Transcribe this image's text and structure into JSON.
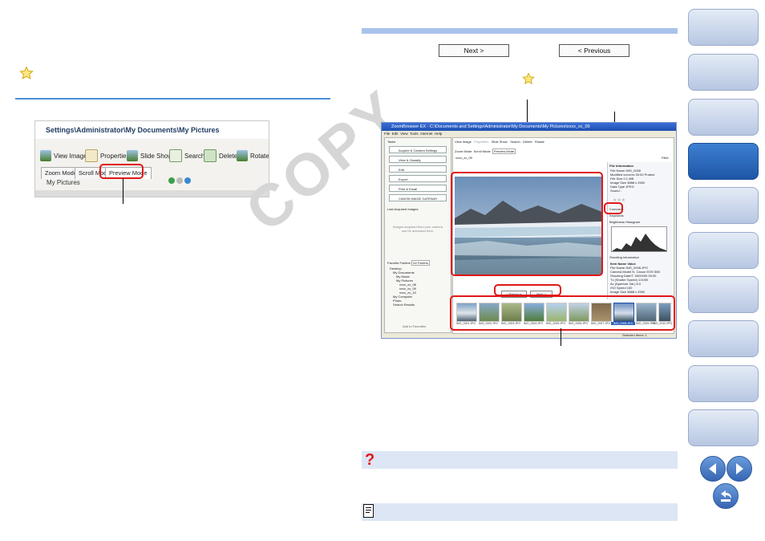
{
  "watermark": "COPY",
  "left": {
    "screenshot": {
      "path": "Settings\\Administrator\\My Documents\\My Pictures",
      "toolbar": {
        "view_image": "View Image",
        "properties": "Properties",
        "slide_show": "Slide Show",
        "search": "Search",
        "delete": "Delete",
        "rotate": "Rotate"
      },
      "tabs": [
        "Zoom Mode",
        "Scroll Mode",
        "Preview Mode"
      ],
      "folder_label": "My Pictures"
    }
  },
  "right": {
    "next_label": "Next >",
    "previous_label": "< Previous",
    "screenshot": {
      "title": "ZoomBrowser EX  -  C:\\Documents and Settings\\Administrator\\My Documents\\My Pictures\\xxxx_xx_09",
      "menu": [
        "File",
        "Edit",
        "View",
        "Tools",
        "Internet",
        "Help"
      ],
      "tasks_header": "Tasks",
      "tasks": [
        "Acquire & Camera Settings",
        "View & Classify",
        "Edit",
        "Export",
        "Print & Email",
        "CANON iMAGE GATEWAY"
      ],
      "last_acquired": "Last Acquired Images",
      "last_acquired_hint": "Images acquired from your camera can be accessed here.",
      "folder_tabs": [
        "Favorite Folders",
        "All Folders"
      ],
      "tree": [
        "Desktop",
        "My Documents",
        "My Music",
        "My Pictures",
        "xxxx_xx_08",
        "xxxx_xx_09",
        "xxxx_xx_10",
        "My Computer",
        "Photo",
        "Search Results"
      ],
      "add_favorites": "Add to Favorites",
      "toolbar": [
        "View Image",
        "Properties",
        "Slide Show",
        "Search",
        "Delete",
        "Rotate"
      ],
      "mode_tabs": [
        "Zoom Mode",
        "Scroll Mode",
        "Preview Mode"
      ],
      "folder_path": "xxxx_xx_09",
      "filter": "Filter",
      "prev_btn": "< Previous",
      "next_btn": "Next >",
      "info_header": "File Information",
      "info": [
        {
          "k": "File Name",
          "v": "IMG_0006"
        },
        {
          "k": "Modified",
          "v": "xx/xx/xx 00:00"
        },
        {
          "k": "File Size",
          "v": "0.1 MB"
        },
        {
          "k": "Image Size",
          "v": "3888 x 2592"
        },
        {
          "k": "Data Type",
          "v": "JPEG"
        },
        {
          "k": "Sound",
          "v": "-"
        }
      ],
      "protect": "Protect",
      "sections": [
        "Comment",
        "Keywords",
        "Brightness Histogram",
        "Shooting Information"
      ],
      "shooting_header": [
        "Item Name",
        "Value"
      ],
      "shooting": [
        {
          "k": "File Name",
          "v": "IMG_0006.JPG"
        },
        {
          "k": "Camera Model N.",
          "v": "Canon EOS 50D"
        },
        {
          "k": "Shooting Date/T.",
          "v": "00/00/00 00:00"
        },
        {
          "k": "Tv (Shutter Speed)",
          "v": "1/1000"
        },
        {
          "k": "Av (Aperture Val.)",
          "v": "8.0"
        },
        {
          "k": "ISO Speed",
          "v": "100"
        },
        {
          "k": "Image Size",
          "v": "3888 x 2592"
        }
      ],
      "thumbs": [
        "IMG_0001.JPG",
        "IMG_0002.JPG",
        "IMG_0003.JPG",
        "IMG_0004.JPG",
        "IMG_0005.JPG",
        "IMG_0006.JPG",
        "IMG_0007.JPG",
        "IMG_0008.JPG",
        "IMG_0009.JPG",
        "IMG_0010.JPG"
      ],
      "status": "Selected Items: 1"
    }
  },
  "colors": {
    "accent_blue": "#4a90d9",
    "highlight_red": "#e01818",
    "sidebar_active": "#1e56a6",
    "hint_band": "#dde6f5"
  },
  "icons": {
    "hint_star": "star-icon",
    "troubleshoot": "question-mark-icon",
    "note": "memo-icon",
    "nav_prev": "left-arrow-icon",
    "nav_next": "right-arrow-icon",
    "nav_back": "return-icon"
  }
}
